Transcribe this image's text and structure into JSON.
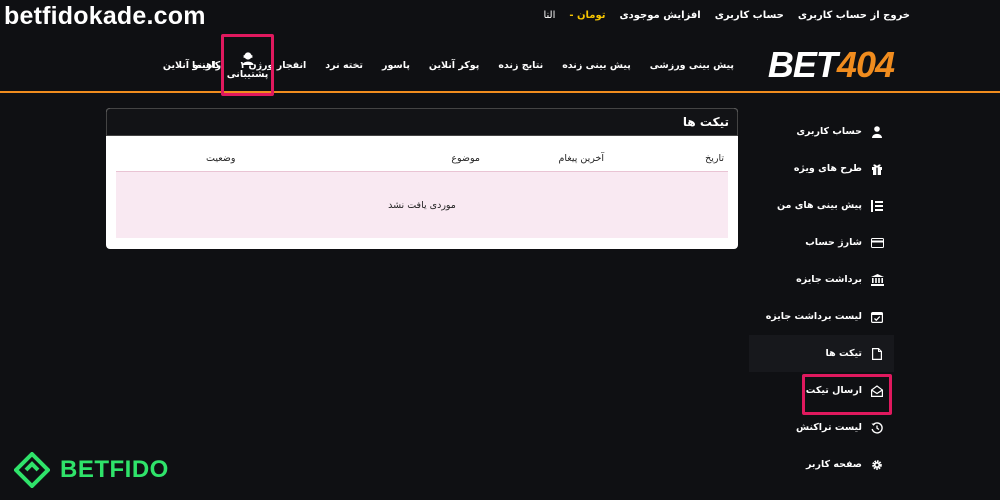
{
  "watermark": {
    "top": "betfidokade.com",
    "bottom": "BETFIDO"
  },
  "topbar": {
    "user": "النا",
    "balance": "تومان -",
    "deposit": "افزایش موجودی",
    "account": "حساب کاربری",
    "logout": "خروج از حساب کاربری"
  },
  "logo": {
    "bet": "BET",
    "num": "404"
  },
  "nav": {
    "items": [
      "پیش بینی ورزشی",
      "پیش بینی زنده",
      "نتایج زنده",
      "پوکر آنلاین",
      "پاسور",
      "تخته نرد",
      "انفجار ورژن ۱",
      "کازینو آنلاین"
    ],
    "support": "پشتیبانی",
    "help": "راهنما"
  },
  "panel": {
    "title": "تیکت ها",
    "columns": [
      "تاریخ",
      "آخرین پیغام",
      "موضوع",
      "وضعیت"
    ],
    "empty": "موردی یافت نشد"
  },
  "sidebar": {
    "items": [
      {
        "label": "حساب کاربری",
        "icon": "user-icon"
      },
      {
        "label": "طرح های ویژه",
        "icon": "gift-icon"
      },
      {
        "label": "پیش بینی های من",
        "icon": "list-icon"
      },
      {
        "label": "شارژ حساب",
        "icon": "card-icon"
      },
      {
        "label": "برداشت جایزه",
        "icon": "bank-icon"
      },
      {
        "label": "لیست برداشت جایزه",
        "icon": "calendar-check-icon"
      },
      {
        "label": "تیکت ها",
        "icon": "file-icon"
      },
      {
        "label": "ارسال تیکت",
        "icon": "envelope-open-icon"
      },
      {
        "label": "لیست تراکنش",
        "icon": "history-icon"
      },
      {
        "label": "صفحه کاربر",
        "icon": "gear-icon"
      }
    ]
  },
  "colors": {
    "accent": "#f08c1e",
    "highlight": "#e0195e",
    "brand_green": "#2fe36a",
    "balance": "#f5c400"
  }
}
